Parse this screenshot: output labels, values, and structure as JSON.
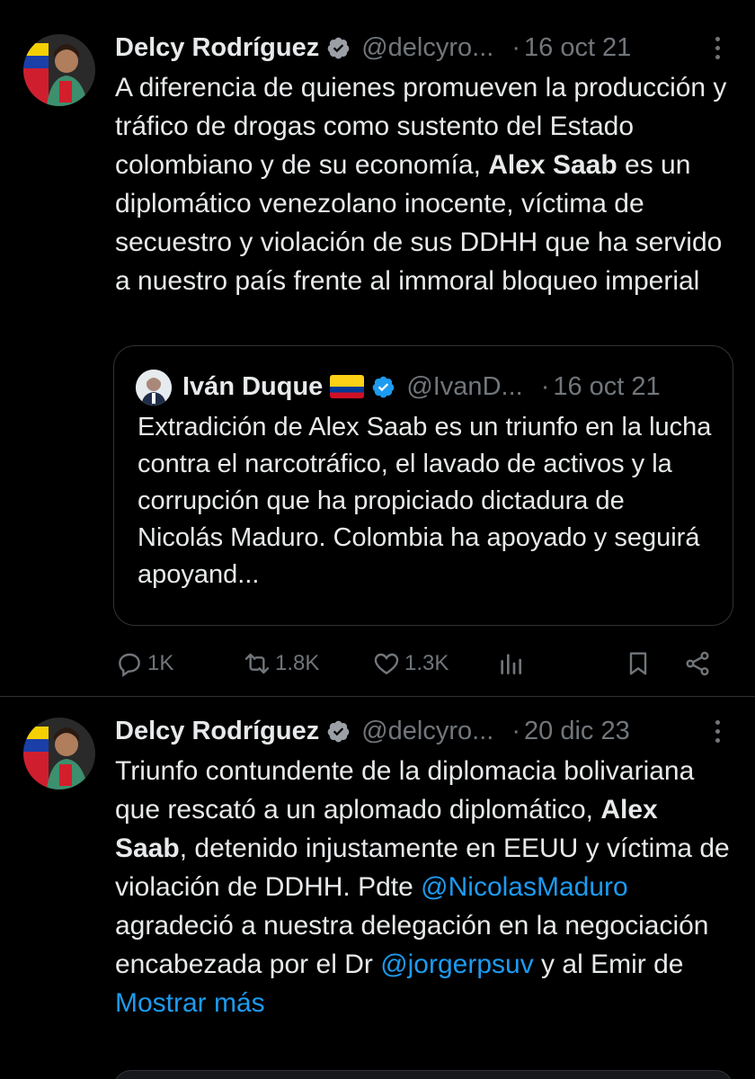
{
  "tweet1": {
    "author_name": "Delcy Rodríguez",
    "author_handle": "@delcyro...",
    "dot": "·",
    "date": "16 oct 21",
    "text_part1": "A diferencia de quienes promueven la producción y tráfico de drogas como sustento del Estado colombiano y de su economía, ",
    "text_bold": "Alex Saab",
    "text_part2": " es un diplomático venezolano inocente, víctima de secuestro y violación de sus DDHH que ha servido a nuestro país frente al immoral bloqueo imperial",
    "quote": {
      "author_name": "Iván Duque",
      "author_handle": "@IvanD...",
      "dot": "·",
      "date": "16 oct 21",
      "text": "Extradición de Alex Saab es un triunfo en la lucha contra el narcotráfico, el lavado de activos y la corrupción que ha propiciado dictadura de Nicolás Maduro. Colombia ha apoyado y seguirá apoyand..."
    },
    "actions": {
      "replies": "1K",
      "reposts": "1.8K",
      "likes": "1.3K"
    }
  },
  "tweet2": {
    "author_name": "Delcy Rodríguez",
    "author_handle": "@delcyro...",
    "dot": "·",
    "date": "20 dic 23",
    "text_a": "Triunfo contundente de la diplomacia bolivariana que rescató a un aplomado diplomático, ",
    "text_bold": "Alex Saab",
    "text_b": ", detenido injustamente en EEUU y víctima de violación de DDHH. Pdte ",
    "mention1": "@NicolasMaduro",
    "text_c": " agradeció a nuestra delegación en la negociación encabezada por el Dr ",
    "mention2": "@jorgerpsuv",
    "text_d": " y al Emir de",
    "show_more": "Mostrar más"
  },
  "colors": {
    "background": "#000000",
    "text": "#e7e9ea",
    "muted": "#71767b",
    "link": "#1d9bf0",
    "border": "#2f3336"
  }
}
